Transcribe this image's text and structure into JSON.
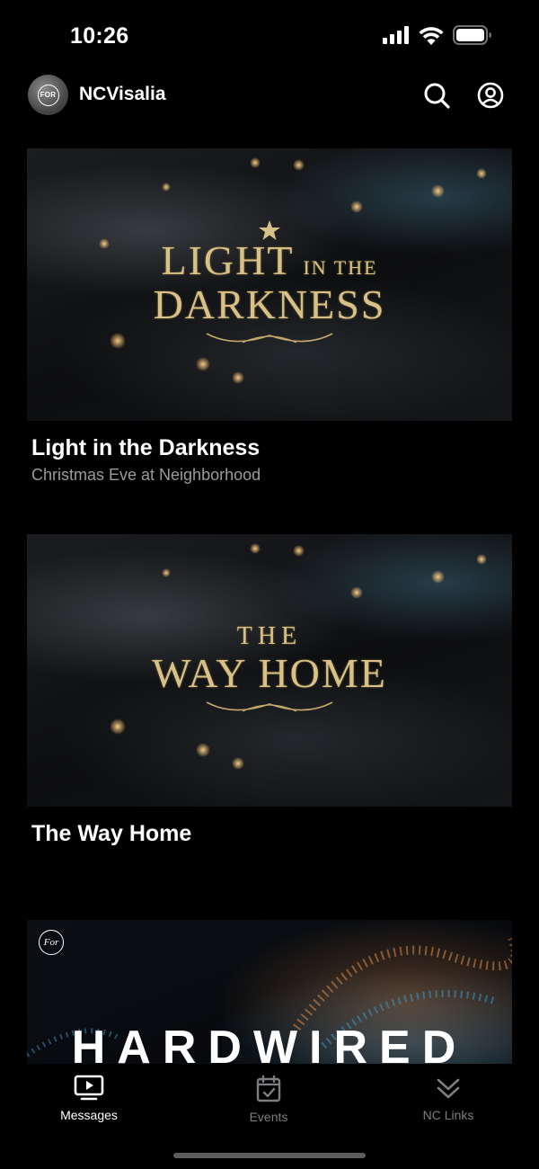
{
  "status_bar": {
    "time": "10:26"
  },
  "header": {
    "avatar_text": "FOR",
    "title": "NCVisalia",
    "search_icon": "search-icon",
    "account_icon": "account-circle-icon"
  },
  "feed": {
    "items": [
      {
        "art_line1": "LIGHT",
        "art_small": "IN THE",
        "art_line2": "DARKNESS",
        "title": "Light in the Darkness",
        "subtitle": "Christmas Eve at Neighborhood"
      },
      {
        "art_line1": "THE",
        "art_line2": "WAY HOME",
        "title": "The Way Home"
      },
      {
        "art_logo": "For",
        "art_line1": "HARDWIRED"
      }
    ]
  },
  "tabs": [
    {
      "label": "Messages",
      "icon": "tv-play-icon",
      "active": true
    },
    {
      "label": "Events",
      "icon": "calendar-check-icon",
      "active": false
    },
    {
      "label": "NC Links",
      "icon": "double-chevron-down-icon",
      "active": false
    }
  ],
  "colors": {
    "background": "#000000",
    "active_tab": "#ffffff",
    "inactive_tab": "#7d7d82",
    "subtitle": "#9a9a9f",
    "gold": "#d8c089"
  }
}
